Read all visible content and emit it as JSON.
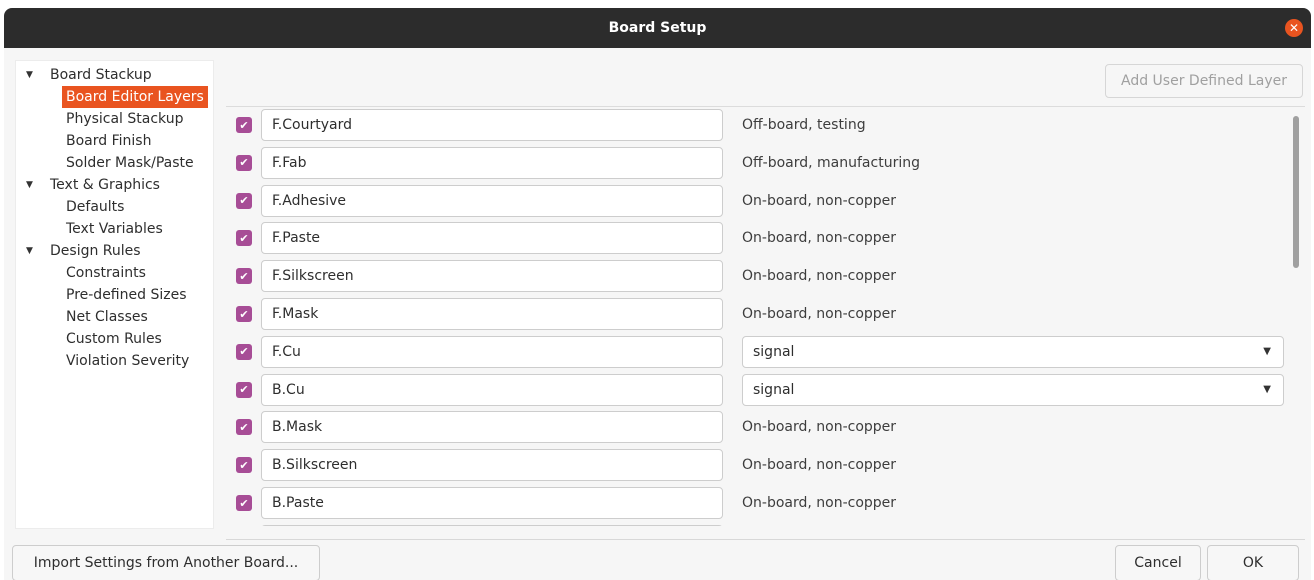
{
  "window": {
    "title": "Board Setup",
    "close_glyph": "✕"
  },
  "tree": {
    "items": [
      {
        "label": "Board Stackup",
        "level": 0,
        "expanded": true
      },
      {
        "label": "Board Editor Layers",
        "level": 1,
        "selected": true
      },
      {
        "label": "Physical Stackup",
        "level": 1
      },
      {
        "label": "Board Finish",
        "level": 1
      },
      {
        "label": "Solder Mask/Paste",
        "level": 1
      },
      {
        "label": "Text & Graphics",
        "level": 0,
        "expanded": true
      },
      {
        "label": "Defaults",
        "level": 1
      },
      {
        "label": "Text Variables",
        "level": 1
      },
      {
        "label": "Design Rules",
        "level": 0,
        "expanded": true
      },
      {
        "label": "Constraints",
        "level": 1
      },
      {
        "label": "Pre-defined Sizes",
        "level": 1
      },
      {
        "label": "Net Classes",
        "level": 1
      },
      {
        "label": "Custom Rules",
        "level": 1
      },
      {
        "label": "Violation Severity",
        "level": 1
      }
    ],
    "expand_glyph": "▼"
  },
  "toolbar": {
    "add_layer_label": "Add User Defined Layer"
  },
  "layers": [
    {
      "name": "F.Courtyard",
      "checked": true,
      "type": "Off-board, testing",
      "editable_type": false
    },
    {
      "name": "F.Fab",
      "checked": true,
      "type": "Off-board, manufacturing",
      "editable_type": false
    },
    {
      "name": "F.Adhesive",
      "checked": true,
      "type": "On-board, non-copper",
      "editable_type": false
    },
    {
      "name": "F.Paste",
      "checked": true,
      "type": "On-board, non-copper",
      "editable_type": false
    },
    {
      "name": "F.Silkscreen",
      "checked": true,
      "type": "On-board, non-copper",
      "editable_type": false
    },
    {
      "name": "F.Mask",
      "checked": true,
      "type": "On-board, non-copper",
      "editable_type": false
    },
    {
      "name": "F.Cu",
      "checked": true,
      "type": "signal",
      "editable_type": true
    },
    {
      "name": "B.Cu",
      "checked": true,
      "type": "signal",
      "editable_type": true
    },
    {
      "name": "B.Mask",
      "checked": true,
      "type": "On-board, non-copper",
      "editable_type": false
    },
    {
      "name": "B.Silkscreen",
      "checked": true,
      "type": "On-board, non-copper",
      "editable_type": false
    },
    {
      "name": "B.Paste",
      "checked": true,
      "type": "On-board, non-copper",
      "editable_type": false
    }
  ],
  "footer": {
    "import_label": "Import Settings from Another Board...",
    "cancel_label": "Cancel",
    "ok_label": "OK"
  },
  "colors": {
    "accent": "#e95420",
    "checkbox": "#a74d96",
    "titlebar": "#2c2c2c"
  }
}
